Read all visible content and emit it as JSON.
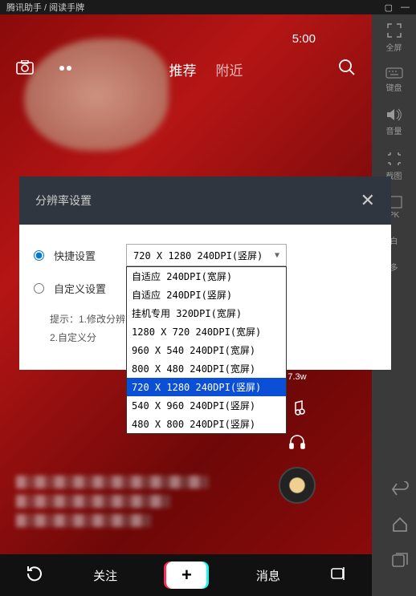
{
  "titlebar": {
    "app_name": "腾讯助手 / 阅读手牌",
    "icon1": "▢",
    "icon2": "—"
  },
  "status": {
    "time": "5:00"
  },
  "top_nav": {
    "tabs": [
      "推荐",
      "附近"
    ],
    "active_index": 0
  },
  "sidebar": {
    "items": [
      {
        "label": "全屏"
      },
      {
        "label": "键盘"
      },
      {
        "label": "音量"
      },
      {
        "label": "截图"
      },
      {
        "label": "PK"
      },
      {
        "label": "白"
      },
      {
        "label": "多"
      }
    ]
  },
  "dialog": {
    "title": "分辨率设置",
    "radio_quick": "快捷设置",
    "radio_custom": "自定义设置",
    "selected_option": "720 X 1280 240DPI(竖屏)",
    "options": [
      "自适应 240DPI(宽屏)",
      "自适应 240DPI(竖屏)",
      "挂机专用 320DPI(宽屏)",
      "1280 X 720 240DPI(宽屏)",
      "960 X 540 240DPI(宽屏)",
      "800 X 480 240DPI(宽屏)",
      "720 X 1280 240DPI(竖屏)",
      "540 X 960 240DPI(竖屏)",
      "480 X 800 240DPI(竖屏)"
    ],
    "selected_dropdown_index": 6,
    "hint1": "提示：1.修改分辨",
    "hint2": "2.自定义分"
  },
  "right_actions": {
    "share_count": "7.3w"
  },
  "bottom_nav": {
    "follow": "关注",
    "messages": "消息"
  }
}
